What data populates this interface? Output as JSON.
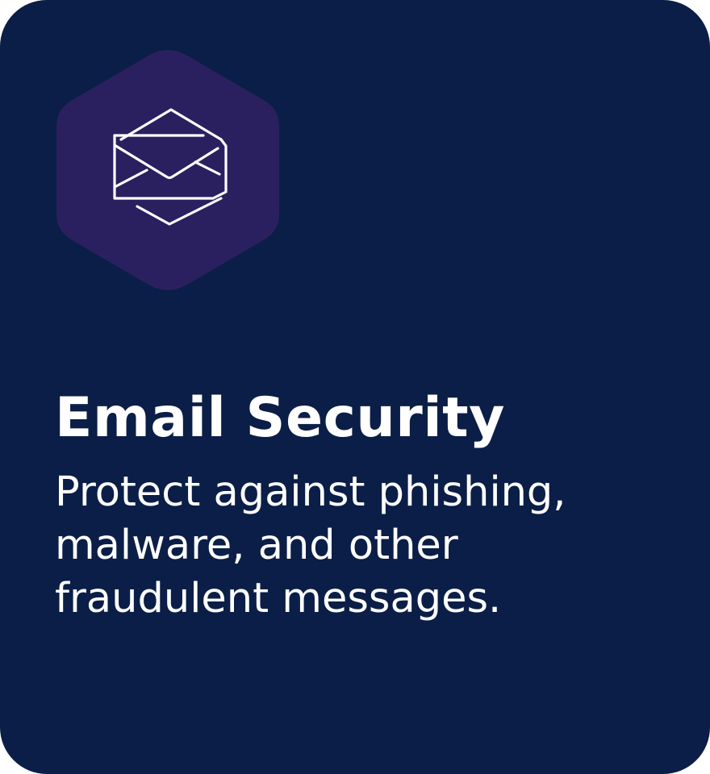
{
  "card": {
    "title": "Email Security",
    "description": "Protect against phishing, malware, and other fraudulent messages.",
    "icon": "email-envelope-icon",
    "colors": {
      "card_background": "#0b1e47",
      "badge_background": "#2a2060",
      "text": "#ffffff"
    }
  }
}
